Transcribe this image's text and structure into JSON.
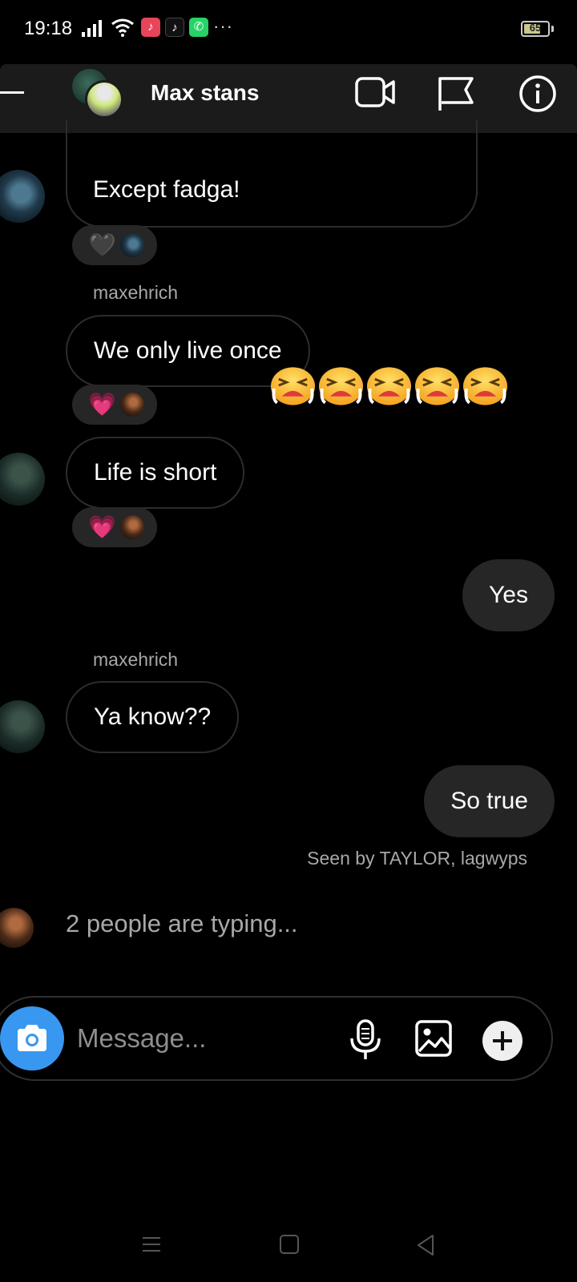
{
  "status_bar": {
    "time": "19:18",
    "battery": "65",
    "battery_level": 0.65,
    "icons": [
      "signal-icon",
      "wifi-icon",
      "music-app-icon",
      "tiktok-icon",
      "whatsapp-icon",
      "more-icon"
    ],
    "more": "···"
  },
  "header": {
    "title": "Max stans",
    "icons": [
      "back-icon",
      "video-call-icon",
      "flag-icon",
      "info-icon"
    ]
  },
  "messages": [
    {
      "text": "Except fadga!",
      "direction": "incoming",
      "reaction": "black-heart"
    },
    {
      "sender": "maxehrich",
      "text": "We only live once",
      "direction": "incoming",
      "reaction": "pink-heart"
    },
    {
      "text": "Life is short",
      "direction": "incoming",
      "reaction": "pink-heart"
    },
    {
      "text": "Yes",
      "direction": "outgoing"
    },
    {
      "sender": "maxehrich",
      "text": "Ya know??",
      "direction": "incoming"
    },
    {
      "text": "So true",
      "direction": "outgoing"
    }
  ],
  "reactions": {
    "black_heart": "🖤",
    "pink_heart": "💗"
  },
  "sticker": {
    "emoji_name": "tired-face-emoji",
    "count": 5
  },
  "seen_text": "Seen by TAYLOR, lagwyps",
  "typing_text": "2 people are typing...",
  "composer": {
    "placeholder": "Message...",
    "icons": [
      "camera-icon",
      "microphone-icon",
      "gallery-icon",
      "plus-icon"
    ]
  },
  "colors": {
    "background": "#000000",
    "header_bg": "#1b1b1b",
    "outgoing_bubble": "#262626",
    "camera_button": "#3897f0",
    "secondary_text": "#a8a8a8"
  },
  "nav_bar": {
    "icons": [
      "menu-icon",
      "home-icon",
      "back-triangle-icon"
    ]
  }
}
